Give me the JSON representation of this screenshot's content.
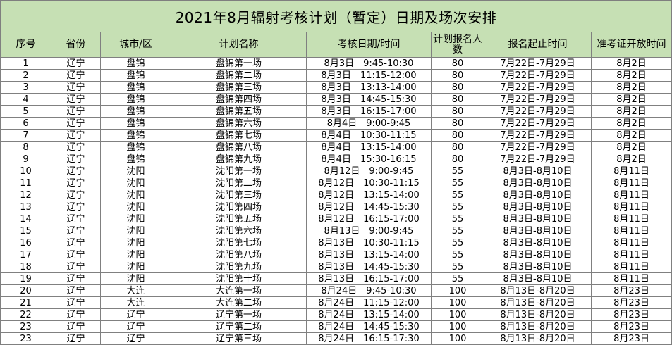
{
  "title": "2021年8月辐射考核计划（暂定）日期及场次安排",
  "colors": {
    "header_bg": "#c6e0b4",
    "grid": "#808080"
  },
  "columns": [
    "序号",
    "省份",
    "城市/区",
    "计划名称",
    "考核日期/时间",
    "计划报名人数",
    "报名起止时间",
    "准考证开放时间"
  ],
  "rows": [
    [
      "1",
      "辽宁",
      "盘锦",
      "盘锦第一场",
      "8月3日　9:45-10:30",
      "80",
      "7月22日-7月29日",
      "8月2日"
    ],
    [
      "2",
      "辽宁",
      "盘锦",
      "盘锦第二场",
      "8月3日　11:15-12:00",
      "80",
      "7月22日-7月29日",
      "8月2日"
    ],
    [
      "3",
      "辽宁",
      "盘锦",
      "盘锦第三场",
      "8月3日　13:13-14:00",
      "80",
      "7月22日-7月29日",
      "8月2日"
    ],
    [
      "4",
      "辽宁",
      "盘锦",
      "盘锦第四场",
      "8月3日　14:45-15:30",
      "80",
      "7月22日-7月29日",
      "8月2日"
    ],
    [
      "5",
      "辽宁",
      "盘锦",
      "盘锦第五场",
      "8月3日　16:15-17:00",
      "80",
      "7月22日-7月29日",
      "8月2日"
    ],
    [
      "6",
      "辽宁",
      "盘锦",
      "盘锦第六场",
      "8月4日　9:00-9:45",
      "80",
      "7月22日-7月29日",
      "8月2日"
    ],
    [
      "7",
      "辽宁",
      "盘锦",
      "盘锦第七场",
      "8月4日　10:30-11:15",
      "80",
      "7月22日-7月29日",
      "8月2日"
    ],
    [
      "8",
      "辽宁",
      "盘锦",
      "盘锦第八场",
      "8月4日　13:15-14:00",
      "80",
      "7月22日-7月29日",
      "8月2日"
    ],
    [
      "9",
      "辽宁",
      "盘锦",
      "盘锦第九场",
      "8月4日　15:30-16:15",
      "80",
      "7月22日-7月29日",
      "8月2日"
    ],
    [
      "10",
      "辽宁",
      "沈阳",
      "沈阳第一场",
      "8月12日　9:00-9:45",
      "55",
      "8月3日-8月10日",
      "8月11日"
    ],
    [
      "11",
      "辽宁",
      "沈阳",
      "沈阳第二场",
      "8月12日　10:30-11:15",
      "55",
      "8月3日-8月10日",
      "8月11日"
    ],
    [
      "12",
      "辽宁",
      "沈阳",
      "沈阳第三场",
      "8月12日　13:15-14:00",
      "55",
      "8月3日-8月10日",
      "8月11日"
    ],
    [
      "13",
      "辽宁",
      "沈阳",
      "沈阳第四场",
      "8月12日　14:45-15:30",
      "55",
      "8月3日-8月10日",
      "8月11日"
    ],
    [
      "14",
      "辽宁",
      "沈阳",
      "沈阳第五场",
      "8月12日　16:15-17:00",
      "55",
      "8月3日-8月10日",
      "8月11日"
    ],
    [
      "15",
      "辽宁",
      "沈阳",
      "沈阳第六场",
      "8月13日　9:00-9:45",
      "55",
      "8月3日-8月10日",
      "8月11日"
    ],
    [
      "16",
      "辽宁",
      "沈阳",
      "沈阳第七场",
      "8月13日　10:30-11:15",
      "55",
      "8月3日-8月10日",
      "8月11日"
    ],
    [
      "17",
      "辽宁",
      "沈阳",
      "沈阳第八场",
      "8月13日　13:15-14:00",
      "55",
      "8月3日-8月10日",
      "8月11日"
    ],
    [
      "18",
      "辽宁",
      "沈阳",
      "沈阳第九场",
      "8月13日　14:45-15:30",
      "55",
      "8月3日-8月10日",
      "8月11日"
    ],
    [
      "19",
      "辽宁",
      "沈阳",
      "沈阳第十场",
      "8月13日　16:15-17:00",
      "55",
      "8月3日-8月10日",
      "8月11日"
    ],
    [
      "20",
      "辽宁",
      "大连",
      "大连第一场",
      "8月24日　9:45-10:30",
      "100",
      "8月13日-8月20日",
      "8月23日"
    ],
    [
      "21",
      "辽宁",
      "大连",
      "大连第二场",
      "8月24日　11:15-12:00",
      "100",
      "8月13日-8月20日",
      "8月23日"
    ],
    [
      "22",
      "辽宁",
      "辽宁",
      "辽宁第一场",
      "8月24日　13:15-14:00",
      "100",
      "8月13日-8月20日",
      "8月23日"
    ],
    [
      "23",
      "辽宁",
      "辽宁",
      "辽宁第二场",
      "8月24日　14:45-15:30",
      "100",
      "8月13日-8月20日",
      "8月23日"
    ],
    [
      "23",
      "辽宁",
      "辽宁",
      "辽宁第三场",
      "8月24日　16:15-17:30",
      "100",
      "8月13日-8月20日",
      "8月23日"
    ]
  ]
}
